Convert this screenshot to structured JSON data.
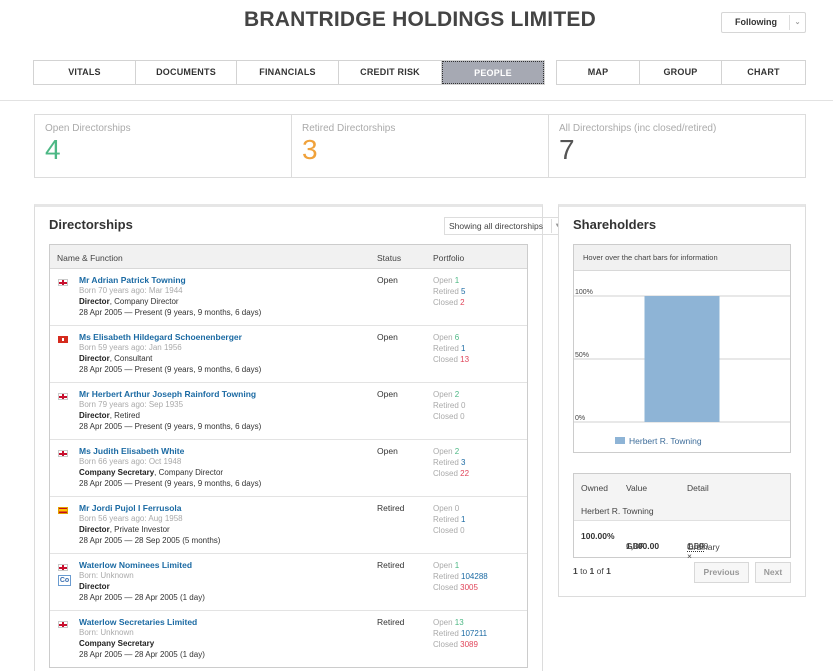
{
  "company": {
    "name": "BRANTRIDGE HOLDINGS LIMITED"
  },
  "follow": {
    "label": "Following",
    "caret": "⌄"
  },
  "tabs_left": [
    "VITALS",
    "DOCUMENTS",
    "FINANCIALS",
    "CREDIT RISK",
    "PEOPLE"
  ],
  "tabs_right": [
    "MAP",
    "GROUP",
    "CHART"
  ],
  "active_tab": "PEOPLE",
  "counts": [
    {
      "label": "Open Directorships",
      "value": "4",
      "color": "#4db885"
    },
    {
      "label": "Retired Directorships",
      "value": "3",
      "color": "#f0a23b"
    },
    {
      "label": "All Directorships (inc closed/retired)",
      "value": "7",
      "color": "#555555"
    }
  ],
  "directorships": {
    "title": "Directorships",
    "filter": "Showing all directorships",
    "columns": {
      "name": "Name & Function",
      "status": "Status",
      "portfolio": "Portfolio"
    },
    "rows": [
      {
        "flag": "uk",
        "name": "Mr Adrian Patrick Towning",
        "born": "Born 70 years ago: Mar 1944",
        "role": "Director",
        "role_detail": ", Company Director",
        "dates": "28 Apr 2005 — Present (9 years, 9 months, 6 days)",
        "status": "Open",
        "open": "1",
        "retired": "5",
        "closed": "2"
      },
      {
        "flag": "ch",
        "name": "Ms Elisabeth Hildegard Schoenenberger",
        "born": "Born 59 years ago: Jan 1956",
        "role": "Director",
        "role_detail": ", Consultant",
        "dates": "28 Apr 2005 — Present (9 years, 9 months, 6 days)",
        "status": "Open",
        "open": "6",
        "retired": "1",
        "closed": "13"
      },
      {
        "flag": "uk",
        "name": "Mr Herbert Arthur Joseph Rainford Towning",
        "born": "Born 79 years ago: Sep 1935",
        "role": "Director",
        "role_detail": ", Retired",
        "dates": "28 Apr 2005 — Present (9 years, 9 months, 6 days)",
        "status": "Open",
        "open": "2",
        "retired": "0",
        "closed": "0"
      },
      {
        "flag": "uk",
        "name": "Ms Judith Elisabeth White",
        "born": "Born 66 years ago: Oct 1948",
        "role": "Company Secretary",
        "role_detail": ", Company Director",
        "dates": "28 Apr 2005 — Present (9 years, 9 months, 6 days)",
        "status": "Open",
        "open": "2",
        "retired": "3",
        "closed": "22"
      },
      {
        "flag": "es",
        "name": "Mr Jordi Pujol I Ferrusola",
        "born": "Born 56 years ago: Aug 1958",
        "role": "Director",
        "role_detail": ", Private Investor",
        "dates": "28 Apr 2005 — 28 Sep 2005 (5 months)",
        "status": "Retired",
        "open": "0",
        "retired": "1",
        "closed": "0"
      },
      {
        "flag": "uk",
        "badge": "Co",
        "name": "Waterlow Nominees Limited",
        "born": "Born: Unknown",
        "role": "Director",
        "role_detail": "",
        "dates": "28 Apr 2005 — 28 Apr 2005 (1 day)",
        "status": "Retired",
        "open": "1",
        "retired": "104288",
        "closed": "3005"
      },
      {
        "flag": "uk",
        "name": "Waterlow Secretaries Limited",
        "born": "Born: Unknown",
        "role": "Company Secretary",
        "role_detail": "",
        "dates": "28 Apr 2005 — 28 Apr 2005 (1 day)",
        "status": "Retired",
        "open": "13",
        "retired": "107211",
        "closed": "3089"
      }
    ],
    "portfolio_labels": {
      "open": "Open ",
      "retired": "Retired ",
      "closed": "Closed "
    }
  },
  "shareholders": {
    "title": "Shareholders",
    "hint": "Hover over the chart bars for information",
    "columns": {
      "owned": "Owned",
      "value": "Value",
      "detail": "Detail"
    },
    "holder": "Herbert R. Towning",
    "owned": "100.00%",
    "value": "1,000.00",
    "value_currency": "GBP",
    "detail_qty": "1,000 × ",
    "detail_price": "1.00",
    "detail_currency": "GBP",
    "detail_class": "Ordinary",
    "pager": {
      "from": "1",
      "to_label": " to ",
      "to": "1",
      "of_label": " of ",
      "total": "1"
    },
    "prev_label": "Previous",
    "next_label": "Next"
  },
  "chart_data": {
    "type": "bar",
    "categories": [
      "Herbert R. Towning"
    ],
    "series": [
      {
        "name": "Herbert R. Towning",
        "values": [
          100
        ],
        "color": "#8eb4d6"
      }
    ],
    "ylim": [
      0,
      100
    ],
    "yticks": [
      "0%",
      "50%",
      "100%"
    ],
    "grid": true,
    "legend": "bottom"
  }
}
